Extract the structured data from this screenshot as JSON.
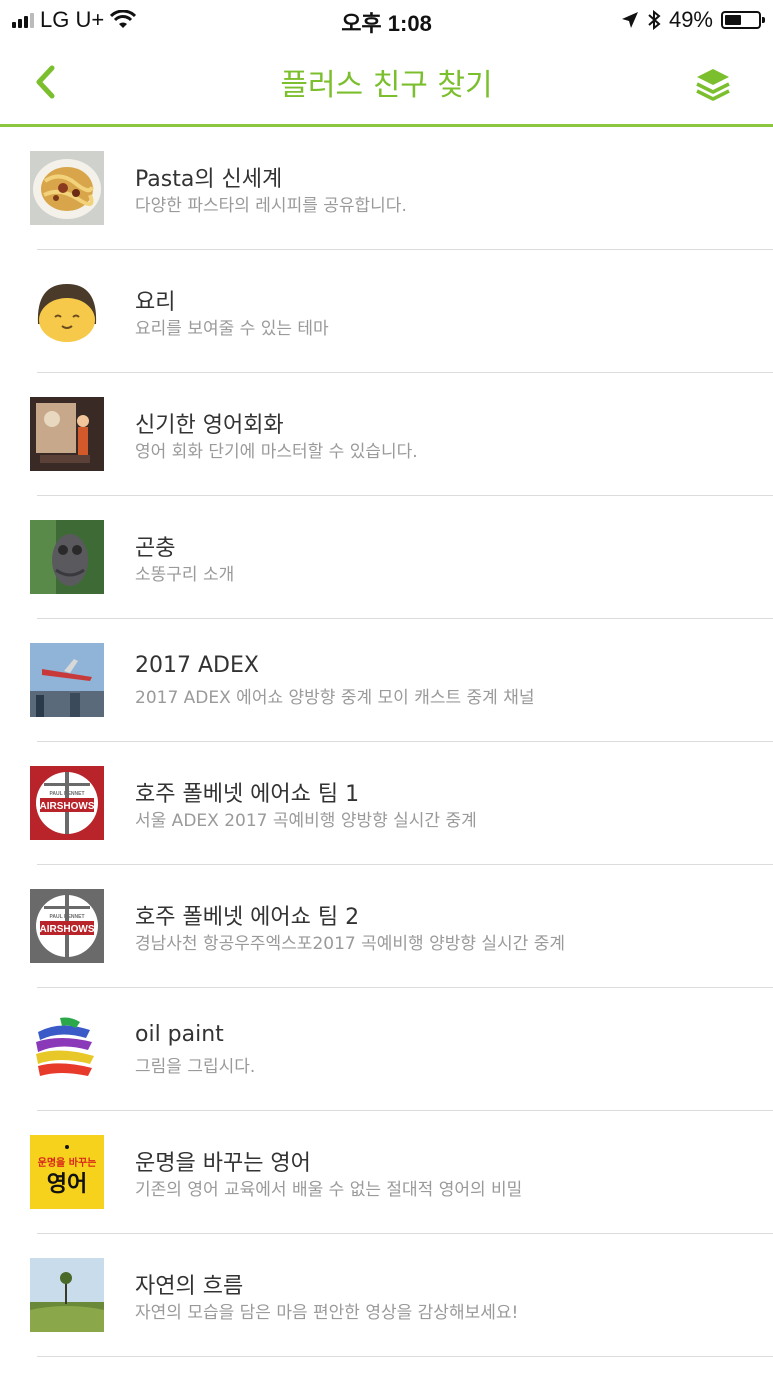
{
  "status_bar": {
    "carrier": "LG U+",
    "time": "오후 1:08",
    "battery": "49%",
    "battery_level": 0.49
  },
  "navbar": {
    "title": "플러스 친구 찾기",
    "accent_color": "#7cbf2e",
    "back_icon": "chevron-left-icon",
    "right_icon": "layers-icon"
  },
  "channels": [
    {
      "name": "Pasta의 신세계",
      "description": "다양한 파스타의 레시피를 공유합니다.",
      "thumb": "pasta-image"
    },
    {
      "name": "요리",
      "description": "요리를 보여줄 수 있는 테마",
      "thumb": "smiling-face-image"
    },
    {
      "name": "신기한 영어회화",
      "description": "영어 회화 단기에 마스터할 수 있습니다.",
      "thumb": "illustration-image"
    },
    {
      "name": "곤충",
      "description": "소똥구리 소개",
      "thumb": "insect-image"
    },
    {
      "name": "2017 ADEX",
      "description": "2017 ADEX 에어쇼 양방향 중계 모이 캐스트 중계 채널",
      "thumb": "airplane-image"
    },
    {
      "name": "호주 폴베넷 에어쇼 팀 1",
      "description": "서울 ADEX 2017 곡예비행 양방향 실시간 중계",
      "thumb": "airshows-logo-red",
      "logo_text": {
        "top": "PAUL BENNET",
        "main": "AIRSHOWS"
      }
    },
    {
      "name": "호주 폴베넷 에어쇼 팀 2",
      "description": "경남사천 항공우주엑스포2017 곡예비행 양방향 실시간 중계",
      "thumb": "airshows-logo-gray",
      "logo_text": {
        "top": "PAUL BENNET",
        "main": "AIRSHOWS"
      }
    },
    {
      "name": "oil paint",
      "description": "그림을 그립시다.",
      "thumb": "paint-image"
    },
    {
      "name": "운명을 바꾸는 영어",
      "description": "기존의 영어 교육에서 배울 수 없는 절대적 영어의 비밀",
      "thumb": "book-cover-image",
      "cover_text": {
        "line1": "운명을 바꾸는",
        "line2": "영어"
      }
    },
    {
      "name": "자연의 흐름",
      "description": "자연의 모습을 담은 마음 편안한 영상을 감상해보세요!",
      "thumb": "nature-image"
    }
  ]
}
